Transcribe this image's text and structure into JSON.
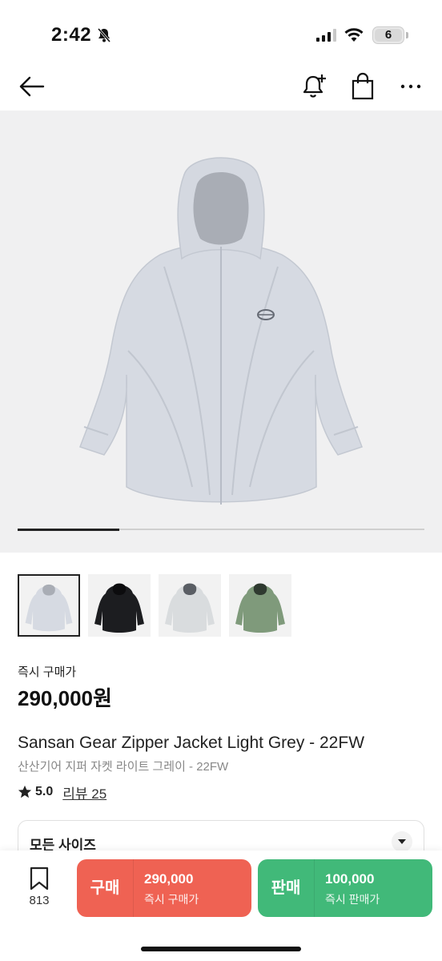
{
  "status_bar": {
    "time": "2:42",
    "battery": "6"
  },
  "nav": {
    "back_icon": "arrow-left-icon",
    "alarm_icon": "bell-plus-icon",
    "bag_icon": "shopping-bag-icon",
    "more_icon": "more-dots-icon"
  },
  "gallery": {
    "progress_fraction": 0.25,
    "thumbnails": [
      {
        "color": "#d6dae2",
        "selected": true
      },
      {
        "color": "#1c1d20",
        "selected": false
      },
      {
        "color": "#d9dcde",
        "selected": false
      },
      {
        "color": "#7f9a7b",
        "selected": false
      }
    ]
  },
  "price": {
    "label": "즉시 구매가",
    "value": "290,000원"
  },
  "product": {
    "title_en": "Sansan Gear Zipper Jacket Light Grey - 22FW",
    "title_ko": "산산기어 지퍼 자켓 라이트 그레이 - 22FW",
    "rating": "5.0",
    "review_label": "리뷰 25"
  },
  "size_selector": {
    "label": "모든 사이즈"
  },
  "bottom_bar": {
    "wish_count": "813",
    "buy": {
      "kind": "구매",
      "price": "290,000",
      "sub": "즉시 구매가",
      "color": "#ef6253"
    },
    "sell": {
      "kind": "판매",
      "price": "100,000",
      "sub": "즉시 판매가",
      "color": "#41b979"
    }
  }
}
